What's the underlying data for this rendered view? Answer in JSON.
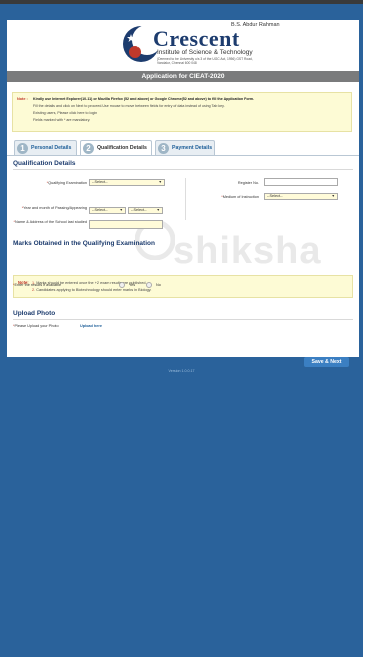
{
  "brand": {
    "prefix": "B.S. Abdur Rahman",
    "name": "Crescent",
    "subtitle": "Institute of Science & Technology",
    "deemed": "(Deemed to be University u/s 3 of the UGC Act, 1956) GST Road, Vandalur, Chennai 600 048"
  },
  "page": {
    "title": "Application for CIEAT-2020"
  },
  "notice": {
    "label": "Note :",
    "line1": "Kindly use Internet Explorer(10-11) or Mozilla Firefox (52 and above) or Google Chrome(52 and above) to fill the Application Form.",
    "line2": "Fill the details and click on Next to proceed.Use mouse to move between fields for entry of data instead of using Tab key.",
    "line3": "Existing users, Please click here to login",
    "line4": "Fields marked with * are mandatory."
  },
  "tabs": [
    {
      "num": "1",
      "label": "Personal Details"
    },
    {
      "num": "2",
      "label": "Qualification Details"
    },
    {
      "num": "3",
      "label": "Payment Details"
    }
  ],
  "qualification": {
    "heading": "Qualification Details",
    "exam_label": "Qualifying Examination",
    "exam_value": "--Select--",
    "year_label": "Year and month of Passing/Appearing",
    "year_value": "--Select--",
    "month_value": "--Select--",
    "school_label": "Name & Address of the School last studied",
    "register_label": "Register No.",
    "register_value": "",
    "medium_label": "Medium of Instruction",
    "medium_value": "--Select--"
  },
  "marks": {
    "heading": "Marks Obtained in the Qualifying Examination",
    "note_label": "Note:",
    "note1_num": "1.",
    "note1": "Marks should be entered once the +2 exam results are published.",
    "note2_num": "2.",
    "note2": "Candidates applying to Biotechnology should enter marks in Biology.",
    "results_label": "Enter the results if available",
    "yes": "Yes",
    "no": "No"
  },
  "upload": {
    "heading": "Upload Photo",
    "label": "Please Upload your Photo",
    "link": "Upload here"
  },
  "actions": {
    "save_next": "Save & Next"
  },
  "watermark": "shiksha",
  "footer": "Version 1.0.0.17"
}
